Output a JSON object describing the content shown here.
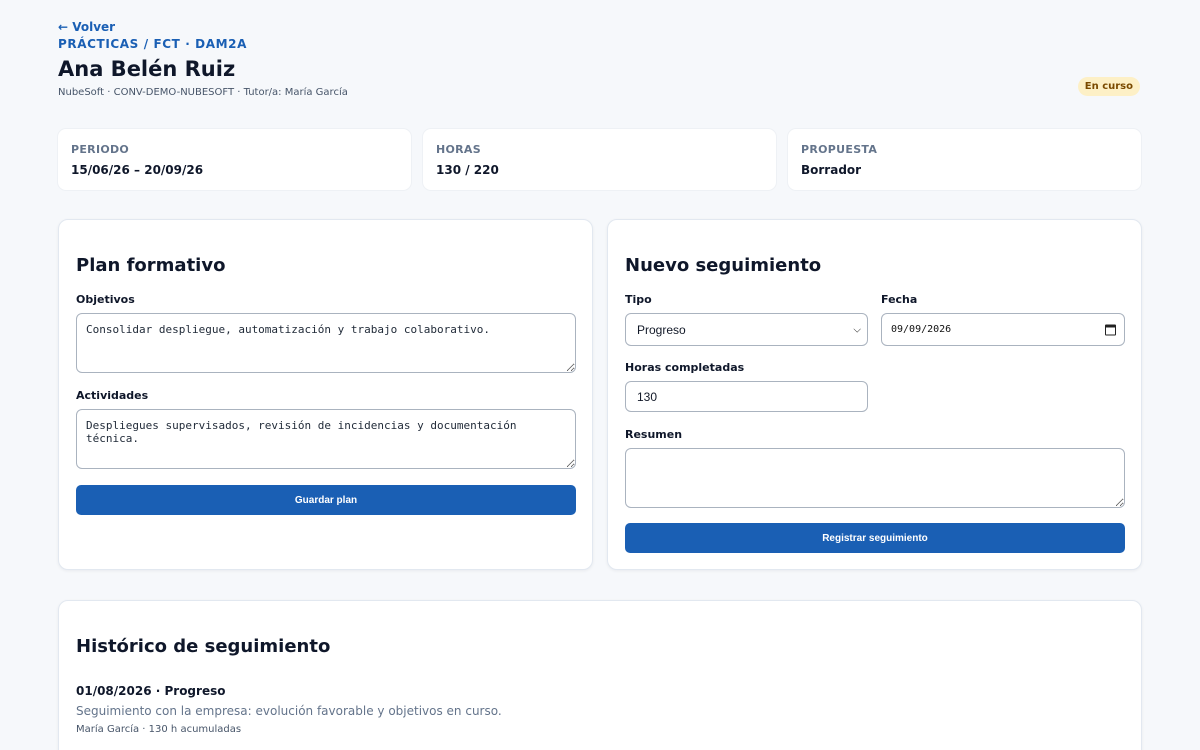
{
  "header": {
    "back_label": "← Volver",
    "breadcrumb": "PRÁCTICAS / FCT · DAM2A",
    "title": "Ana Belén Ruiz",
    "subtitle": "NubeSoft · CONV-DEMO-NUBESOFT · Tutor/a: María García",
    "status": "En curso"
  },
  "stats": [
    {
      "label": "PERIODO",
      "value": "15/06/26 – 20/09/26"
    },
    {
      "label": "HORAS",
      "value": "130 / 220"
    },
    {
      "label": "PROPUESTA",
      "value": "Borrador"
    }
  ],
  "plan": {
    "title": "Plan formativo",
    "objetivos_label": "Objetivos",
    "objetivos_value": "Consolidar despliegue, automatización y trabajo colaborativo.",
    "actividades_label": "Actividades",
    "actividades_value": "Despliegues supervisados, revisión de incidencias y documentación técnica.",
    "save_label": "Guardar plan"
  },
  "seguimiento": {
    "title": "Nuevo seguimiento",
    "tipo_label": "Tipo",
    "tipo_value": "Progreso",
    "fecha_label": "Fecha",
    "fecha_value": "09/09/2026",
    "horas_label": "Horas completadas",
    "horas_value": "130",
    "resumen_label": "Resumen",
    "resumen_value": "",
    "submit_label": "Registrar seguimiento"
  },
  "history": {
    "title": "Histórico de seguimiento",
    "entries": [
      {
        "head": "01/08/2026 · Progreso",
        "text": "Seguimiento con la empresa: evolución favorable y objetivos en curso.",
        "meta": "María García · 130 h acumuladas"
      }
    ]
  }
}
